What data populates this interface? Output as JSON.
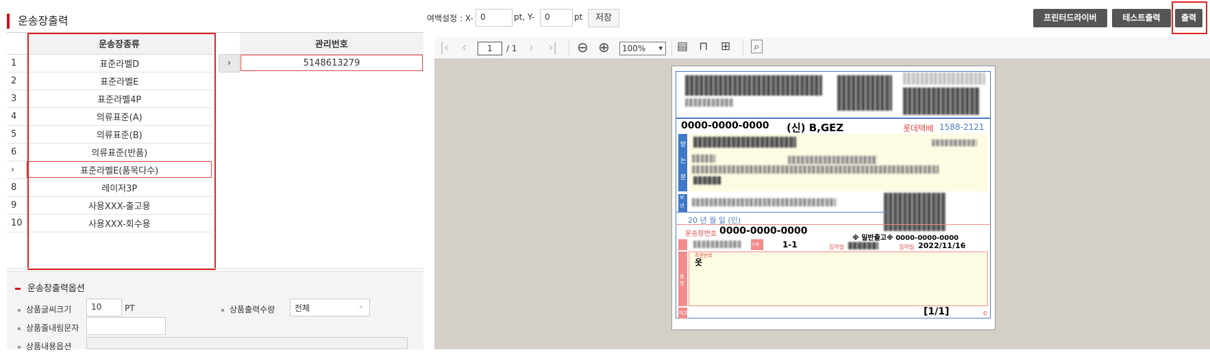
{
  "page_title": "운송장출력",
  "waybill_table": {
    "header": "운송장종류",
    "rows": [
      {
        "num": "1",
        "name": "표준라벨D"
      },
      {
        "num": "2",
        "name": "표준라벨E"
      },
      {
        "num": "3",
        "name": "표준라벨4P"
      },
      {
        "num": "4",
        "name": "의류표준(A)"
      },
      {
        "num": "5",
        "name": "의류표준(B)"
      },
      {
        "num": "6",
        "name": "의류표준(반품)"
      },
      {
        "num": "›",
        "name": "표준라벨E(품목다수)"
      },
      {
        "num": "8",
        "name": "레이저3P"
      },
      {
        "num": "9",
        "name": "사용XXX-출고용"
      },
      {
        "num": "10",
        "name": "사용XXX-회수용"
      }
    ]
  },
  "mgmt_table": {
    "header": "관리번호",
    "row": {
      "arrow": "›",
      "value": "5148613279"
    }
  },
  "options": {
    "title": "운송장출력옵션",
    "font_size_label": "상품글씨크기",
    "font_size_value": "10",
    "font_size_unit": "PT",
    "qty_label": "상품출력수량",
    "qty_value": "전체",
    "linebreak_label": "상품줄내림문자",
    "linebreak_value": "",
    "content_option_label": "상품내용옵션"
  },
  "margin": {
    "label": "여백설정 : X-",
    "x_value": "0",
    "x_unit": "pt, Y-",
    "y_value": "0",
    "y_unit": "pt",
    "save_label": "저장"
  },
  "buttons": {
    "printer_driver": "프린터드라이버",
    "test_print": "테스트출력",
    "print": "출력"
  },
  "viewer": {
    "page_current": "1",
    "page_total": "/ 1",
    "zoom": "100%"
  },
  "label": {
    "phone_top": "0000-0000-0000",
    "name_top": "(신) B,GEZ",
    "carrier": "롯데택배",
    "carrier_phone": "1588-2121",
    "date_row": "20  년  월  일  (인)",
    "waybill_no_label": "운송장번호",
    "waybill_no": "0000-0000-0000",
    "general_out": "※ 일반출고※ 0000-0000-0000",
    "count": "1-1",
    "pickup_date_label": "집하일",
    "pickup_date": "2022/11/16",
    "item_label": "주문번호",
    "item": "옷",
    "page_mark": "[1/1]",
    "side_send": "받는분",
    "side_from": "보낸분",
    "side_qty": "수량",
    "side_item": "품명",
    "side_note": "비고"
  }
}
